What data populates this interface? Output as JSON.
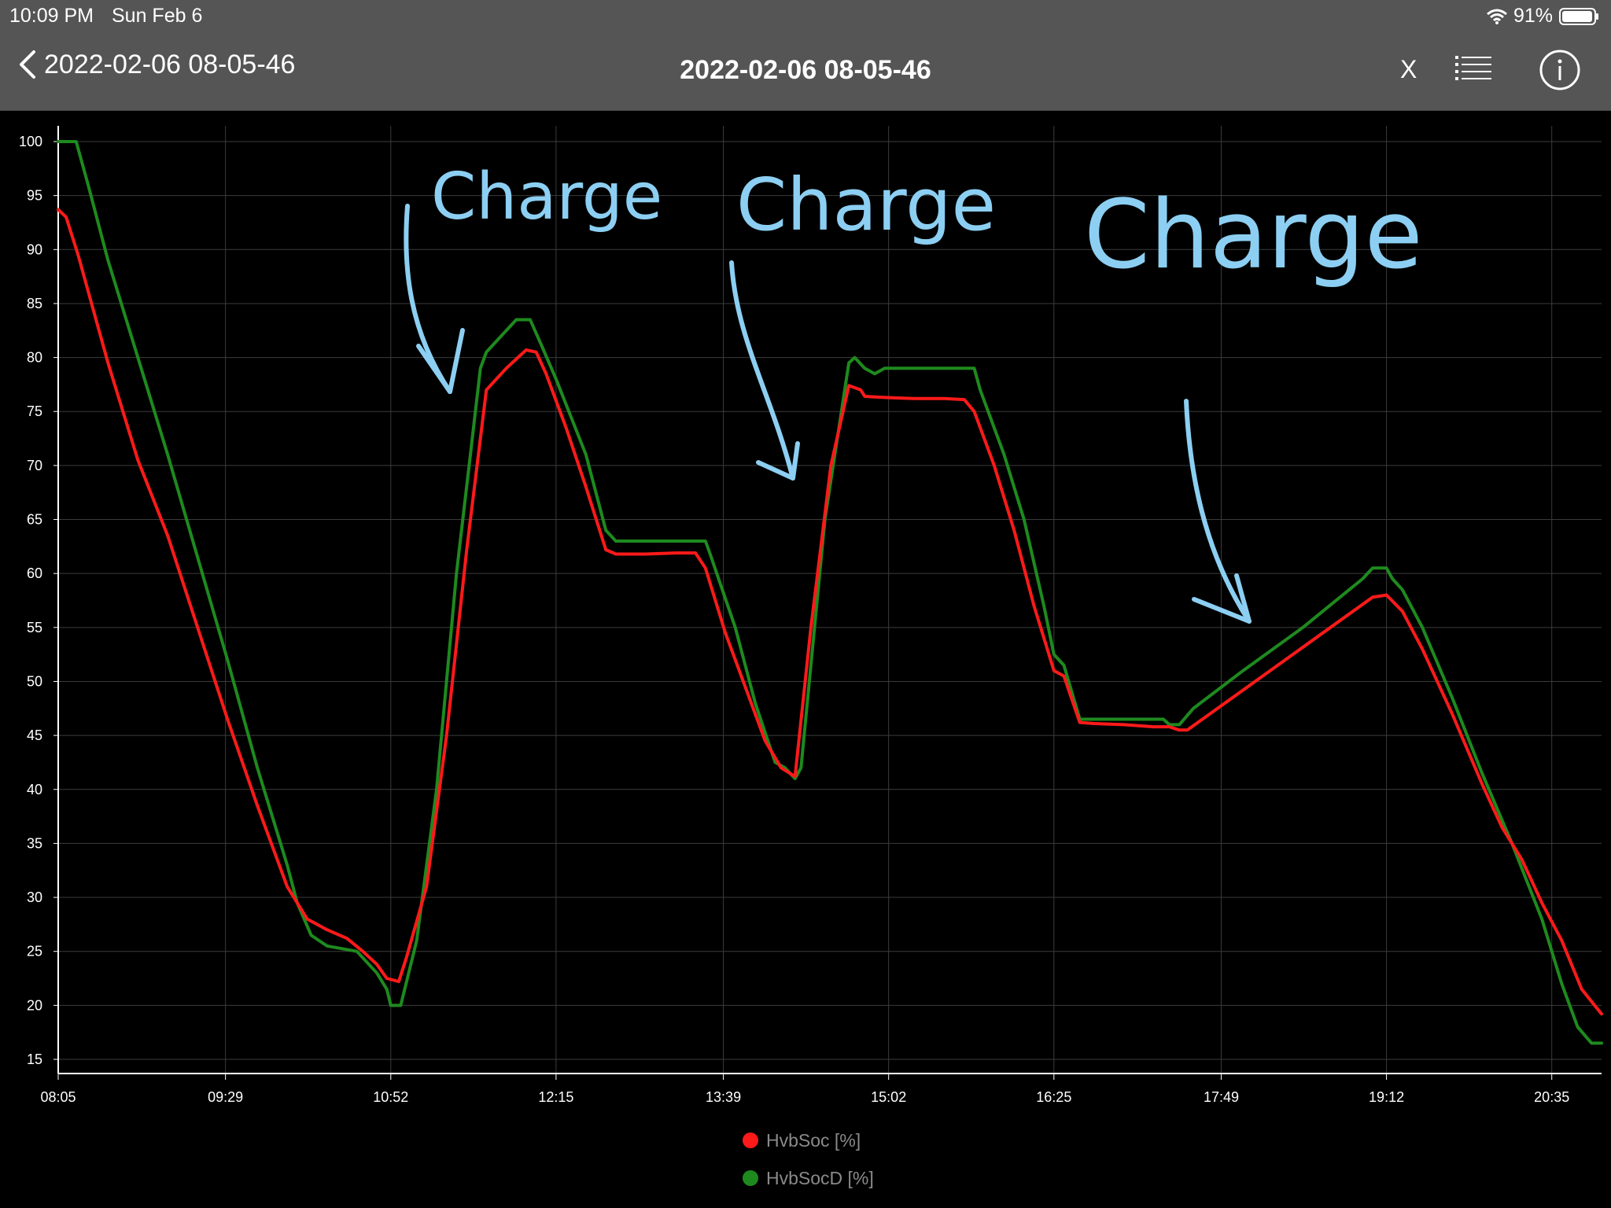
{
  "status_bar": {
    "time": "10:09 PM",
    "date": "Sun Feb 6",
    "battery": "91%"
  },
  "nav": {
    "back_label": "2022-02-06 08-05-46",
    "title": "2022-02-06 08-05-46",
    "close_label": "X"
  },
  "annotations": [
    "Charge",
    "Charge",
    "Charge"
  ],
  "colors": {
    "bar": "#555555",
    "background": "#000000",
    "grid": "#3c3c3c",
    "hvbsoc": "#ff1a1a",
    "hvbsocd": "#1e8a1e",
    "annotation": "#8ccff2"
  },
  "chart_data": {
    "type": "line",
    "x_ticks": [
      "08:05",
      "09:29",
      "10:52",
      "12:15",
      "13:39",
      "15:02",
      "16:25",
      "17:49",
      "19:12",
      "20:35"
    ],
    "xlim": [
      "08:05",
      "21:00"
    ],
    "ylim": [
      14,
      101
    ],
    "y_ticks": [
      100,
      95,
      90,
      85,
      80,
      75,
      70,
      65,
      60,
      55,
      50,
      45,
      40,
      35,
      30,
      25,
      20,
      15
    ],
    "grid": true,
    "legend_position": "bottom-center",
    "series": [
      {
        "name": "HvbSoc [%]",
        "color": "#ff1a1a",
        "points": [
          [
            "08:05",
            93.7
          ],
          [
            "08:09",
            93
          ],
          [
            "08:15",
            89.5
          ],
          [
            "08:30",
            79.5
          ],
          [
            "08:45",
            70.5
          ],
          [
            "09:00",
            63.5
          ],
          [
            "09:15",
            55
          ],
          [
            "09:30",
            46.5
          ],
          [
            "09:45",
            38.5
          ],
          [
            "10:00",
            31
          ],
          [
            "10:10",
            28
          ],
          [
            "10:20",
            27
          ],
          [
            "10:30",
            26.2
          ],
          [
            "10:38",
            25
          ],
          [
            "10:45",
            23.8
          ],
          [
            "10:50",
            22.5
          ],
          [
            "10:56",
            22.2
          ],
          [
            "11:00",
            24.5
          ],
          [
            "11:10",
            31
          ],
          [
            "11:20",
            45
          ],
          [
            "11:30",
            62
          ],
          [
            "11:40",
            77
          ],
          [
            "11:50",
            79
          ],
          [
            "12:00",
            80.7
          ],
          [
            "12:05",
            80.5
          ],
          [
            "12:10",
            78.5
          ],
          [
            "12:20",
            73.5
          ],
          [
            "12:30",
            68
          ],
          [
            "12:40",
            62.2
          ],
          [
            "12:45",
            61.8
          ],
          [
            "13:00",
            61.8
          ],
          [
            "13:15",
            61.9
          ],
          [
            "13:25",
            61.9
          ],
          [
            "13:30",
            60.5
          ],
          [
            "13:40",
            54.5
          ],
          [
            "13:50",
            49.5
          ],
          [
            "14:00",
            44.5
          ],
          [
            "14:08",
            42
          ],
          [
            "14:15",
            41.2
          ],
          [
            "14:23",
            55
          ],
          [
            "14:33",
            70
          ],
          [
            "14:42",
            77.4
          ],
          [
            "14:48",
            77
          ],
          [
            "14:50",
            76.4
          ],
          [
            "15:00",
            76.3
          ],
          [
            "15:15",
            76.2
          ],
          [
            "15:30",
            76.2
          ],
          [
            "15:40",
            76.1
          ],
          [
            "15:45",
            75
          ],
          [
            "15:55",
            70
          ],
          [
            "16:05",
            64
          ],
          [
            "16:15",
            57
          ],
          [
            "16:25",
            51
          ],
          [
            "16:30",
            50.5
          ],
          [
            "16:38",
            46.2
          ],
          [
            "16:45",
            46.1
          ],
          [
            "17:00",
            46
          ],
          [
            "17:15",
            45.8
          ],
          [
            "17:23",
            45.8
          ],
          [
            "17:28",
            45.5
          ],
          [
            "17:32",
            45.5
          ],
          [
            "19:05",
            57.8
          ],
          [
            "19:12",
            58
          ],
          [
            "19:20",
            56.5
          ],
          [
            "19:30",
            53
          ],
          [
            "19:45",
            47
          ],
          [
            "20:00",
            40.5
          ],
          [
            "20:10",
            36.5
          ],
          [
            "20:20",
            33.5
          ],
          [
            "20:30",
            29.5
          ],
          [
            "20:40",
            26
          ],
          [
            "20:50",
            21.5
          ],
          [
            "21:00",
            19.2
          ]
        ]
      },
      {
        "name": "HvbSocD [%]",
        "color": "#1e8a1e",
        "points": [
          [
            "08:05",
            100
          ],
          [
            "08:14",
            100
          ],
          [
            "08:20",
            96
          ],
          [
            "08:30",
            89
          ],
          [
            "08:45",
            80
          ],
          [
            "09:00",
            71
          ],
          [
            "09:15",
            61.5
          ],
          [
            "09:30",
            52
          ],
          [
            "09:45",
            42
          ],
          [
            "10:00",
            33
          ],
          [
            "10:05",
            29.5
          ],
          [
            "10:12",
            26.5
          ],
          [
            "10:20",
            25.5
          ],
          [
            "10:35",
            25
          ],
          [
            "10:45",
            23
          ],
          [
            "10:50",
            21.5
          ],
          [
            "10:52",
            20
          ],
          [
            "10:57",
            20
          ],
          [
            "11:05",
            26
          ],
          [
            "11:15",
            40
          ],
          [
            "11:25",
            60
          ],
          [
            "11:32",
            71
          ],
          [
            "11:37",
            79
          ],
          [
            "11:40",
            80.5
          ],
          [
            "11:50",
            82.5
          ],
          [
            "11:55",
            83.5
          ],
          [
            "12:02",
            83.5
          ],
          [
            "12:08",
            81
          ],
          [
            "12:15",
            78
          ],
          [
            "12:30",
            71
          ],
          [
            "12:40",
            64
          ],
          [
            "12:45",
            63
          ],
          [
            "13:00",
            63
          ],
          [
            "13:15",
            63
          ],
          [
            "13:30",
            63
          ],
          [
            "13:32",
            62
          ],
          [
            "13:45",
            55
          ],
          [
            "13:55",
            48
          ],
          [
            "14:05",
            42.5
          ],
          [
            "14:10",
            42
          ],
          [
            "14:15",
            41
          ],
          [
            "14:18",
            42
          ],
          [
            "14:30",
            65
          ],
          [
            "14:42",
            79.5
          ],
          [
            "14:45",
            80
          ],
          [
            "14:50",
            79
          ],
          [
            "14:55",
            78.5
          ],
          [
            "15:00",
            79
          ],
          [
            "15:30",
            79
          ],
          [
            "15:45",
            79
          ],
          [
            "15:48",
            77
          ],
          [
            "16:00",
            71
          ],
          [
            "16:10",
            65
          ],
          [
            "16:20",
            57
          ],
          [
            "16:25",
            52.5
          ],
          [
            "16:30",
            51.5
          ],
          [
            "16:38",
            46.5
          ],
          [
            "16:45",
            46.5
          ],
          [
            "17:00",
            46.5
          ],
          [
            "17:15",
            46.5
          ],
          [
            "17:20",
            46.5
          ],
          [
            "17:23",
            46
          ],
          [
            "17:28",
            46
          ],
          [
            "17:35",
            47.5
          ],
          [
            "18:00",
            51
          ],
          [
            "18:30",
            55
          ],
          [
            "19:00",
            59.5
          ],
          [
            "19:05",
            60.5
          ],
          [
            "19:12",
            60.5
          ],
          [
            "19:15",
            59.5
          ],
          [
            "19:20",
            58.5
          ],
          [
            "19:30",
            55
          ],
          [
            "19:45",
            48.5
          ],
          [
            "20:00",
            41.5
          ],
          [
            "20:15",
            35
          ],
          [
            "20:30",
            28
          ],
          [
            "20:40",
            22
          ],
          [
            "20:48",
            18
          ],
          [
            "20:55",
            16.5
          ],
          [
            "21:00",
            16.5
          ]
        ]
      }
    ]
  }
}
